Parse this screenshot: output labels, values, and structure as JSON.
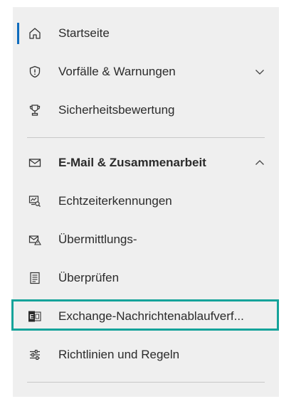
{
  "nav": {
    "items": [
      {
        "label": "Startseite",
        "icon": "home-icon",
        "active": true
      },
      {
        "label": "Vorfälle & Warnungen",
        "icon": "shield-alert-icon",
        "chevron": "down"
      },
      {
        "label": "Sicherheitsbewertung",
        "icon": "trophy-icon"
      },
      {
        "label": "E-Mail & Zusammenarbeit",
        "icon": "mail-icon",
        "chevron": "up",
        "bold": true
      },
      {
        "label": "Echtzeiterkennungen",
        "icon": "realtime-detection-icon"
      },
      {
        "label": "Übermittlungs-",
        "icon": "submissions-icon"
      },
      {
        "label": "Überprüfen",
        "icon": "review-list-icon"
      },
      {
        "label": "Exchange-Nachrichtenablaufverf...",
        "icon": "exchange-icon",
        "highlighted": true
      },
      {
        "label": "Richtlinien und Regeln",
        "icon": "sliders-icon"
      }
    ]
  },
  "colors": {
    "active_indicator": "#0f6cbd",
    "highlight_border": "#15a39a",
    "nav_background": "#efefef"
  }
}
